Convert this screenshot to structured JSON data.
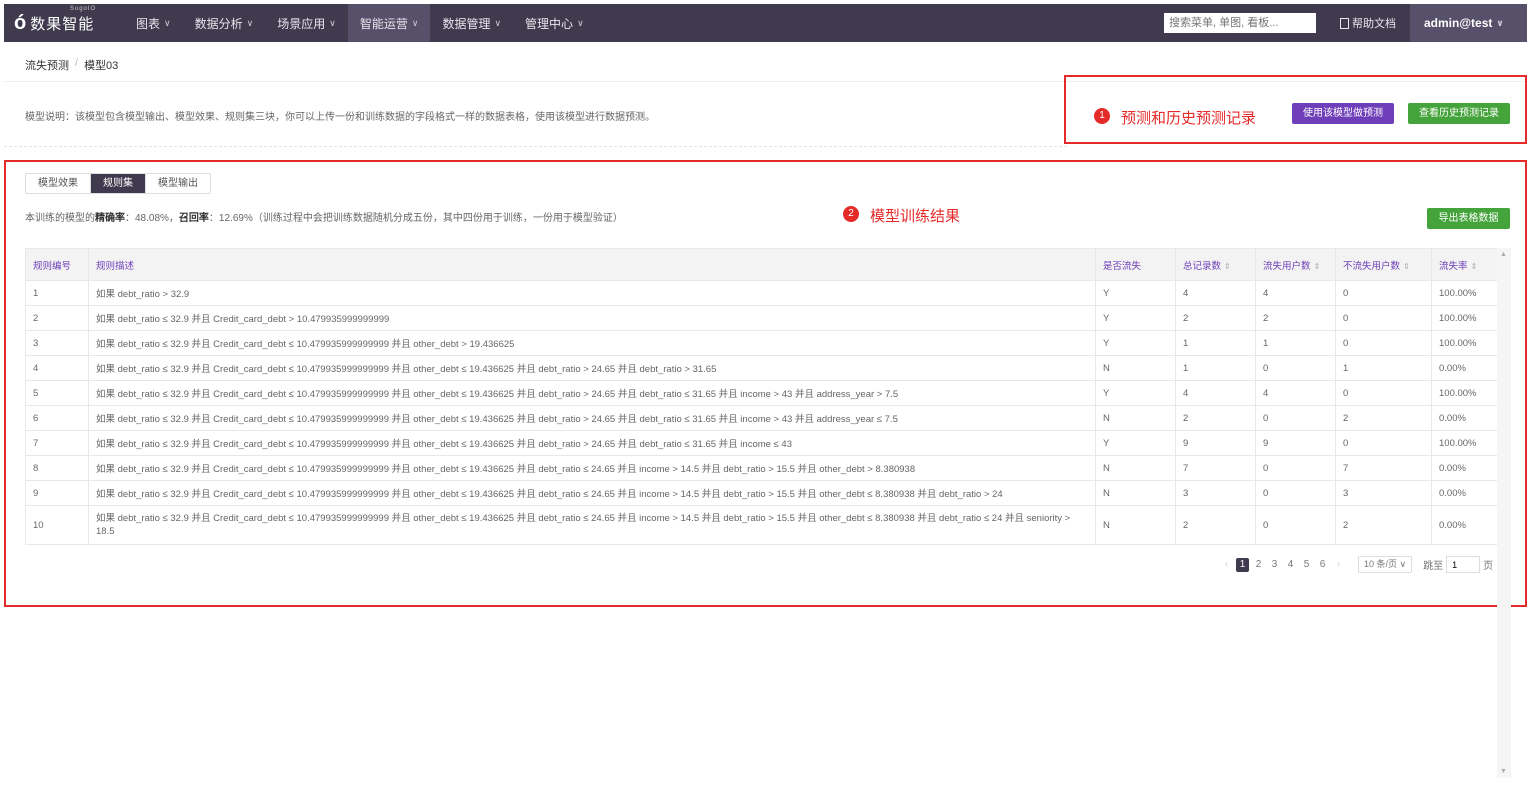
{
  "logo": {
    "mark": "ó",
    "text": "数果智能",
    "sub": "SugoIO"
  },
  "nav": [
    {
      "label": "图表",
      "active": false
    },
    {
      "label": "数据分析",
      "active": false
    },
    {
      "label": "场景应用",
      "active": false
    },
    {
      "label": "智能运营",
      "active": true
    },
    {
      "label": "数据管理",
      "active": false
    },
    {
      "label": "管理中心",
      "active": false
    }
  ],
  "header": {
    "search_placeholder": "搜索菜单, 单图, 看板...",
    "help_label": "帮助文档",
    "user": "admin@test"
  },
  "breadcrumb": {
    "parent": "流失预测",
    "separator": "/",
    "current": "模型03"
  },
  "description": "模型说明：该模型包含模型输出、模型效果、规则集三块，你可以上传一份和训练数据的字段格式一样的数据表格，使用该模型进行数据预测。",
  "annotations": {
    "a1": {
      "num": "1",
      "label": "预测和历史预测记录"
    },
    "a2": {
      "num": "2",
      "label": "模型训练结果"
    }
  },
  "buttons": {
    "predict": "使用该模型做预测",
    "history": "查看历史预测记录",
    "export": "导出表格数据"
  },
  "tabs": [
    {
      "label": "模型效果",
      "active": false
    },
    {
      "label": "规则集",
      "active": true
    },
    {
      "label": "模型输出",
      "active": false
    }
  ],
  "stats": {
    "prefix": "本训练的模型的",
    "precision_label": "精确率",
    "precision_value": "：48.08%，",
    "recall_label": "召回率",
    "recall_value": "：12.69%（训练过程中会把训练数据随机分成五份，其中四份用于训练，一份用于模型验证）"
  },
  "table": {
    "columns": [
      "规则编号",
      "规则描述",
      "是否流失",
      "总记录数",
      "流失用户数",
      "不流失用户数",
      "流失率"
    ],
    "rows": [
      [
        "1",
        "如果 debt_ratio > 32.9",
        "Y",
        "4",
        "4",
        "0",
        "100.00%"
      ],
      [
        "2",
        "如果 debt_ratio ≤ 32.9 并且 Credit_card_debt > 10.479935999999999",
        "Y",
        "2",
        "2",
        "0",
        "100.00%"
      ],
      [
        "3",
        "如果 debt_ratio ≤ 32.9 并且 Credit_card_debt ≤ 10.479935999999999 并且 other_debt > 19.436625",
        "Y",
        "1",
        "1",
        "0",
        "100.00%"
      ],
      [
        "4",
        "如果 debt_ratio ≤ 32.9 并且 Credit_card_debt ≤ 10.479935999999999 并且 other_debt ≤ 19.436625 并且 debt_ratio > 24.65 并且 debt_ratio > 31.65",
        "N",
        "1",
        "0",
        "1",
        "0.00%"
      ],
      [
        "5",
        "如果 debt_ratio ≤ 32.9 并且 Credit_card_debt ≤ 10.479935999999999 并且 other_debt ≤ 19.436625 并且 debt_ratio > 24.65 并且 debt_ratio ≤ 31.65 并且 income > 43 并且 address_year > 7.5",
        "Y",
        "4",
        "4",
        "0",
        "100.00%"
      ],
      [
        "6",
        "如果 debt_ratio ≤ 32.9 并且 Credit_card_debt ≤ 10.479935999999999 并且 other_debt ≤ 19.436625 并且 debt_ratio > 24.65 并且 debt_ratio ≤ 31.65 并且 income > 43 并且 address_year ≤ 7.5",
        "N",
        "2",
        "0",
        "2",
        "0.00%"
      ],
      [
        "7",
        "如果 debt_ratio ≤ 32.9 并且 Credit_card_debt ≤ 10.479935999999999 并且 other_debt ≤ 19.436625 并且 debt_ratio > 24.65 并且 debt_ratio ≤ 31.65 并且 income ≤ 43",
        "Y",
        "9",
        "9",
        "0",
        "100.00%"
      ],
      [
        "8",
        "如果 debt_ratio ≤ 32.9 并且 Credit_card_debt ≤ 10.479935999999999 并且 other_debt ≤ 19.436625 并且 debt_ratio ≤ 24.65 并且 income > 14.5 并且 debt_ratio > 15.5 并且 other_debt > 8.380938",
        "N",
        "7",
        "0",
        "7",
        "0.00%"
      ],
      [
        "9",
        "如果 debt_ratio ≤ 32.9 并且 Credit_card_debt ≤ 10.479935999999999 并且 other_debt ≤ 19.436625 并且 debt_ratio ≤ 24.65 并且 income > 14.5 并且 debt_ratio > 15.5 并且 other_debt ≤ 8.380938 并且 debt_ratio > 24",
        "N",
        "3",
        "0",
        "3",
        "0.00%"
      ],
      [
        "10",
        "如果 debt_ratio ≤ 32.9 并且 Credit_card_debt ≤ 10.479935999999999 并且 other_debt ≤ 19.436625 并且 debt_ratio ≤ 24.65 并且 income > 14.5 并且 debt_ratio > 15.5 并且 other_debt ≤ 8.380938 并且 debt_ratio ≤ 24 并且 seniority > 18.5",
        "N",
        "2",
        "0",
        "2",
        "0.00%"
      ]
    ]
  },
  "pagination": {
    "prev": "‹",
    "pages": [
      "1",
      "2",
      "3",
      "4",
      "5",
      "6"
    ],
    "current": "1",
    "next": "›",
    "page_size": "10 条/页",
    "jump_label": "跳至",
    "jump_value": "1",
    "page_unit": "页"
  },
  "colors": {
    "topbar": "#403a4e",
    "accent_purple": "#6e3fb8",
    "accent_green": "#45a33b",
    "annotation_red": "#e52a2a"
  }
}
